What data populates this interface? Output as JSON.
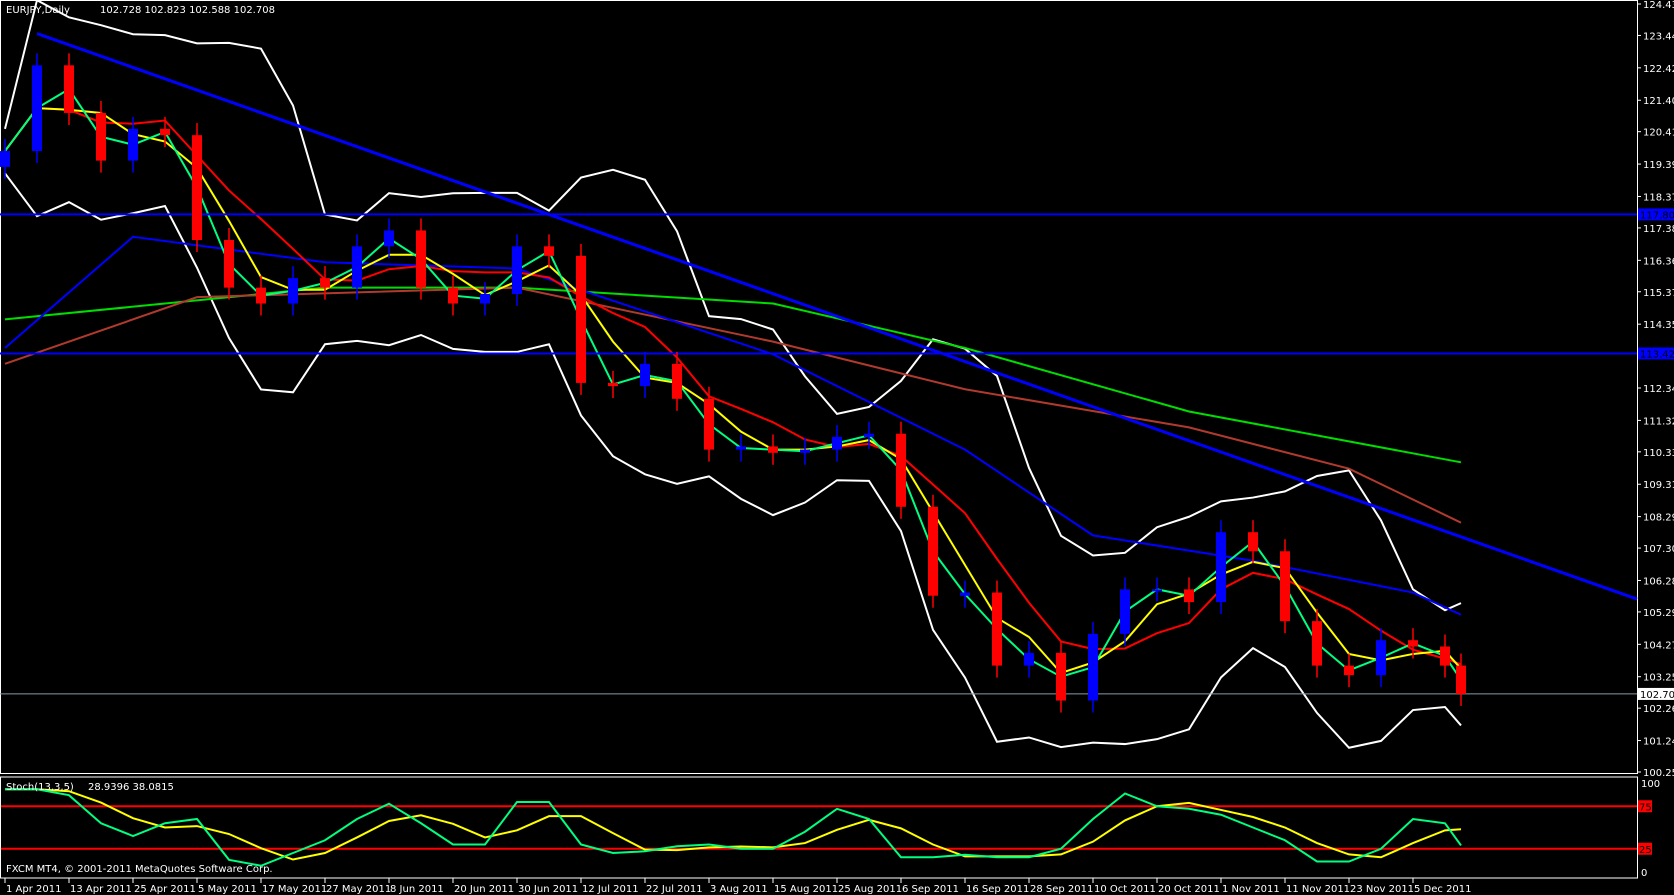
{
  "header": {
    "symbol": "EURJPY,Daily",
    "ohlc": "102.728 102.823 102.588 102.708"
  },
  "stoch": {
    "label": "Stoch(13,3,5)",
    "values": "28.9396 38.0815",
    "levels": [
      75,
      25
    ],
    "scale": [
      "100",
      "0"
    ]
  },
  "footer": {
    "copyright": "FXCM MT4, © 2001-2011 MetaQuotes Software Corp."
  },
  "colors": {
    "bull": "#0000ff",
    "bear": "#ff0000",
    "ma_fast": "#00ff80",
    "ma_mid": "#ffff00",
    "ma_slow": "#ff0000",
    "ma_blue": "#0000ff",
    "ma_brown": "#b03a2e",
    "ma_green": "#00dd00",
    "bands": "#ffffff",
    "trendline": "#0000ff",
    "stoch_k": "#00ff80",
    "stoch_d": "#ffff00"
  },
  "chart_data": {
    "type": "candlestick",
    "title": "EURJPY,Daily",
    "ylim": [
      100.25,
      124.43
    ],
    "y_ticks": [
      "124.430",
      "123.440",
      "122.420",
      "121.400",
      "120.410",
      "119.390",
      "118.370",
      "117.380",
      "116.360",
      "115.370",
      "114.350",
      "112.340",
      "111.320",
      "110.330",
      "109.310",
      "108.290",
      "107.300",
      "106.280",
      "105.290",
      "104.270",
      "103.250",
      "102.260",
      "101.240",
      "100.250"
    ],
    "x_ticks": [
      "1 Apr 2011",
      "13 Apr 2011",
      "25 Apr 2011",
      "5 May 2011",
      "17 May 2011",
      "27 May 2011",
      "8 Jun 2011",
      "20 Jun 2011",
      "30 Jun 2011",
      "12 Jul 2011",
      "22 Jul 2011",
      "3 Aug 2011",
      "15 Aug 2011",
      "25 Aug 2011",
      "6 Sep 2011",
      "16 Sep 2011",
      "28 Sep 2011",
      "10 Oct 2011",
      "20 Oct 2011",
      "1 Nov 2011",
      "11 Nov 2011",
      "23 Nov 2011",
      "5 Dec 2011"
    ],
    "candles": [
      [
        "2011-04-01",
        119.8
      ],
      [
        "2011-04-07",
        122.5
      ],
      [
        "2011-04-13",
        121.0
      ],
      [
        "2011-04-19",
        119.5
      ],
      [
        "2011-04-25",
        120.5
      ],
      [
        "2011-04-29",
        120.3
      ],
      [
        "2011-05-05",
        117.0
      ],
      [
        "2011-05-11",
        115.5
      ],
      [
        "2011-05-17",
        115.0
      ],
      [
        "2011-05-23",
        115.8
      ],
      [
        "2011-05-27",
        115.5
      ],
      [
        "2011-06-02",
        116.8
      ],
      [
        "2011-06-08",
        117.3
      ],
      [
        "2011-06-14",
        115.5
      ],
      [
        "2011-06-20",
        115.0
      ],
      [
        "2011-06-24",
        115.3
      ],
      [
        "2011-06-30",
        116.8
      ],
      [
        "2011-07-06",
        116.5
      ],
      [
        "2011-07-12",
        112.5
      ],
      [
        "2011-07-18",
        112.4
      ],
      [
        "2011-07-22",
        113.1
      ],
      [
        "2011-07-28",
        112.0
      ],
      [
        "2011-08-03",
        110.4
      ],
      [
        "2011-08-09",
        110.5
      ],
      [
        "2011-08-15",
        110.3
      ],
      [
        "2011-08-19",
        110.4
      ],
      [
        "2011-08-25",
        110.8
      ],
      [
        "2011-08-31",
        110.9
      ],
      [
        "2011-09-06",
        108.6
      ],
      [
        "2011-09-12",
        105.8
      ],
      [
        "2011-09-16",
        105.9
      ],
      [
        "2011-09-22",
        103.6
      ],
      [
        "2011-09-28",
        104.0
      ],
      [
        "2011-10-04",
        102.5
      ],
      [
        "2011-10-10",
        104.6
      ],
      [
        "2011-10-14",
        106.0
      ],
      [
        "2011-10-20",
        106.0
      ],
      [
        "2011-10-26",
        105.6
      ],
      [
        "2011-11-01",
        107.8
      ],
      [
        "2011-11-07",
        107.2
      ],
      [
        "2011-11-11",
        105.0
      ],
      [
        "2011-11-17",
        103.6
      ],
      [
        "2011-11-23",
        103.3
      ],
      [
        "2011-11-29",
        104.4
      ],
      [
        "2011-12-05",
        104.2
      ],
      [
        "2011-12-09",
        103.6
      ],
      [
        "2011-12-13",
        102.708
      ]
    ],
    "ma_blue": [
      [
        "2011-04-01",
        113.6
      ],
      [
        "2011-04-25",
        117.1
      ],
      [
        "2011-05-27",
        116.3
      ],
      [
        "2011-06-30",
        116.1
      ],
      [
        "2011-08-15",
        113.4
      ],
      [
        "2011-09-16",
        110.4
      ],
      [
        "2011-10-10",
        107.7
      ],
      [
        "2011-11-07",
        106.9
      ],
      [
        "2011-12-05",
        105.9
      ],
      [
        "2011-12-13",
        105.2
      ]
    ],
    "ma_brown": [
      [
        "2011-04-01",
        113.1
      ],
      [
        "2011-05-05",
        115.2
      ],
      [
        "2011-06-30",
        115.5
      ],
      [
        "2011-08-15",
        113.8
      ],
      [
        "2011-09-16",
        112.3
      ],
      [
        "2011-10-26",
        111.1
      ],
      [
        "2011-11-23",
        109.8
      ],
      [
        "2011-12-13",
        108.1
      ]
    ],
    "ma_green": [
      [
        "2011-04-01",
        114.5
      ],
      [
        "2011-05-27",
        115.5
      ],
      [
        "2011-06-30",
        115.5
      ],
      [
        "2011-08-15",
        115.0
      ],
      [
        "2011-09-16",
        113.6
      ],
      [
        "2011-10-26",
        111.6
      ],
      [
        "2011-12-13",
        110.0
      ]
    ],
    "trendline": [
      [
        "2011-04-07",
        123.5
      ],
      [
        "2011-11-23",
        108.9
      ]
    ],
    "hlines": [
      {
        "value": 117.805,
        "label": "117.805"
      },
      {
        "value": 113.428,
        "label": "113.428"
      }
    ],
    "current_price": {
      "value": 102.708,
      "label": "102.708"
    },
    "stoch_k": [
      95,
      95,
      88,
      55,
      40,
      55,
      60,
      12,
      5,
      20,
      35,
      60,
      78,
      55,
      30,
      30,
      80,
      80,
      30,
      20,
      22,
      28,
      30,
      25,
      25,
      45,
      72,
      60,
      15,
      15,
      18,
      15,
      15,
      25,
      60,
      90,
      75,
      72,
      65,
      50,
      35,
      10,
      10,
      25,
      60,
      55,
      28.94
    ]
  }
}
